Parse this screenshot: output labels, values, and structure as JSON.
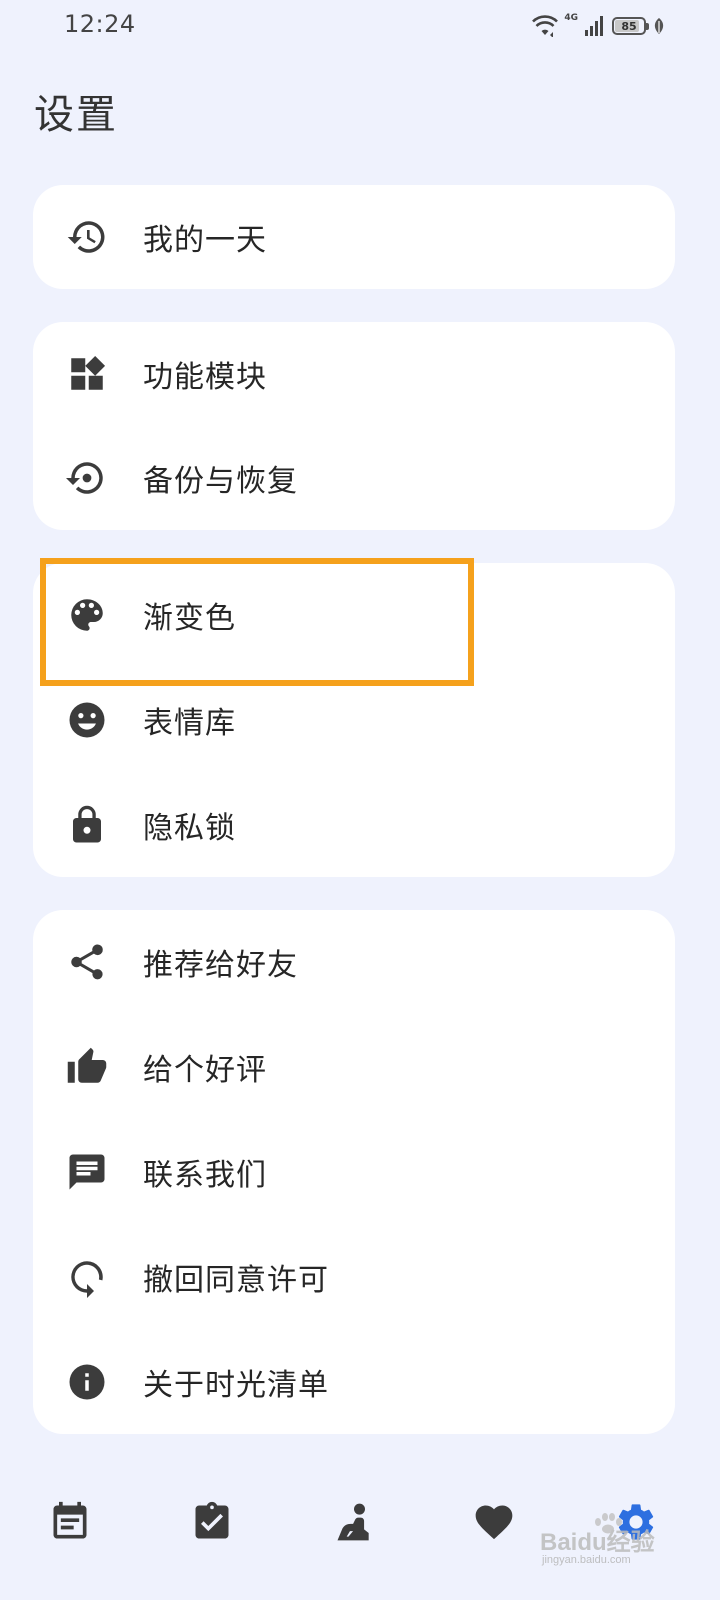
{
  "status_bar": {
    "time": "12:24",
    "network": "4G",
    "battery": "85",
    "battery_level": 0.85
  },
  "page_title": "设置",
  "groups": [
    {
      "items": [
        {
          "label": "我的一天",
          "icon": "history-icon"
        }
      ]
    },
    {
      "items": [
        {
          "label": "功能模块",
          "icon": "widgets-icon"
        },
        {
          "label": "备份与恢复",
          "icon": "restore-icon"
        }
      ]
    },
    {
      "items": [
        {
          "label": "渐变色",
          "icon": "palette-icon"
        },
        {
          "label": "表情库",
          "icon": "emoji-icon"
        },
        {
          "label": "隐私锁",
          "icon": "lock-icon"
        }
      ]
    },
    {
      "items": [
        {
          "label": "推荐给好友",
          "icon": "share-icon"
        },
        {
          "label": "给个好评",
          "icon": "thumb-up-icon"
        },
        {
          "label": "联系我们",
          "icon": "message-icon"
        },
        {
          "label": "撤回同意许可",
          "icon": "revoke-icon"
        },
        {
          "label": "关于时光清单",
          "icon": "info-icon"
        }
      ]
    }
  ],
  "highlight_color": "#f5a11c",
  "accent_color": "#2d6fe0",
  "bottom_nav": [
    {
      "icon": "calendar-list-icon",
      "active": false
    },
    {
      "icon": "clipboard-check-icon",
      "active": false
    },
    {
      "icon": "reading-person-icon",
      "active": false
    },
    {
      "icon": "heart-icon",
      "active": false
    },
    {
      "icon": "settings-icon",
      "active": true
    }
  ],
  "watermark": {
    "text": "Baidu经验",
    "subtext": "jingyan.baidu.com"
  }
}
